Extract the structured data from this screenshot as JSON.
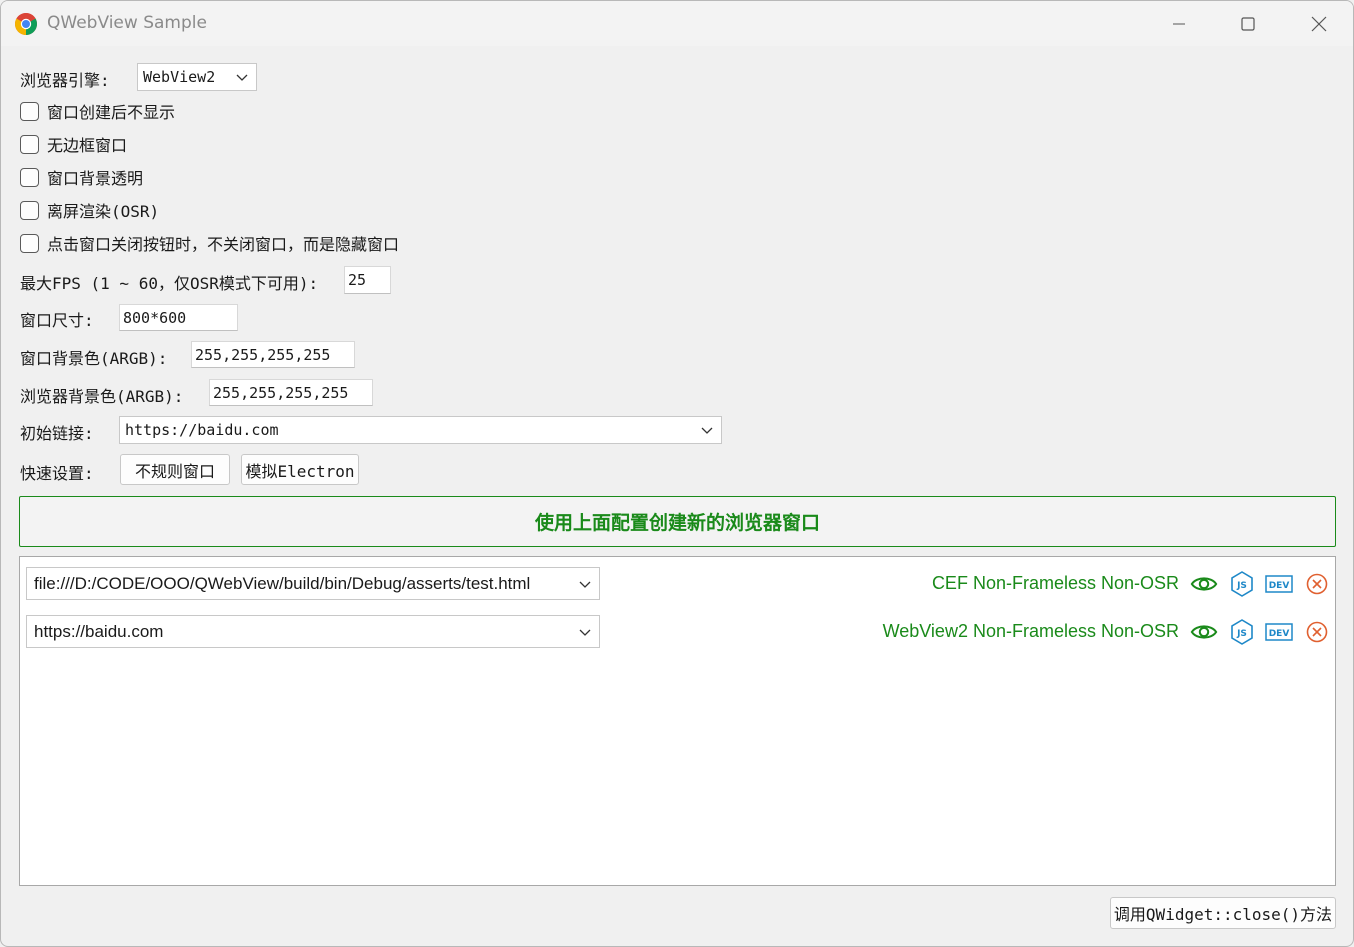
{
  "window": {
    "title": "QWebView Sample",
    "app_icon": "chrome-icon",
    "controls": [
      "minimize-icon",
      "maximize-icon",
      "close-icon"
    ]
  },
  "engine": {
    "label": "浏览器引擎:",
    "selected": "WebView2"
  },
  "checkboxes": [
    {
      "label": "窗口创建后不显示",
      "checked": false
    },
    {
      "label": "无边框窗口",
      "checked": false
    },
    {
      "label": "窗口背景透明",
      "checked": false
    },
    {
      "label": "离屏渲染(OSR)",
      "checked": false
    },
    {
      "label": "点击窗口关闭按钮时，不关闭窗口，而是隐藏窗口",
      "checked": false
    }
  ],
  "fps": {
    "label": "最大FPS (1 ~ 60，仅OSR模式下可用):",
    "value": "25"
  },
  "size": {
    "label": "窗口尺寸:",
    "value": "800*600"
  },
  "window_bg": {
    "label": "窗口背景色(ARGB):",
    "value": "255,255,255,255"
  },
  "browser_bg": {
    "label": "浏览器背景色(ARGB):",
    "value": "255,255,255,255"
  },
  "initial_url": {
    "label": "初始链接:",
    "value": "https://baidu.com"
  },
  "quick": {
    "label": "快速设置:",
    "buttons": [
      "不规则窗口",
      "模拟Electron"
    ]
  },
  "create_button": "使用上面配置创建新的浏览器窗口",
  "browsers": [
    {
      "url": "file:///D:/CODE/OOO/QWebView/build/bin/Debug/asserts/test.html",
      "status": "CEF Non-Frameless Non-OSR"
    },
    {
      "url": "https://baidu.com",
      "status": "WebView2 Non-Frameless Non-OSR"
    }
  ],
  "row_actions": {
    "dev_text": "DEV",
    "js_text": "JS"
  },
  "colors": {
    "accent_green": "#1a8a1a",
    "icon_blue": "#1e88c8",
    "icon_red": "#e06030"
  },
  "close_method_button": "调用QWidget::close()方法"
}
